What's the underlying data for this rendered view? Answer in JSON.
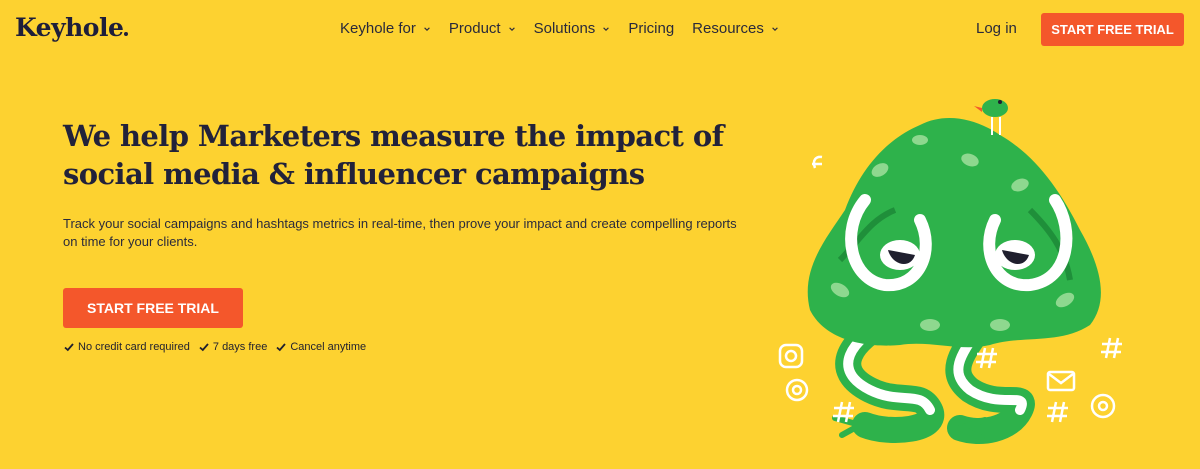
{
  "brand": {
    "name": "Keyhole"
  },
  "nav": {
    "items": [
      {
        "label": "Keyhole for",
        "dropdown": true
      },
      {
        "label": "Product",
        "dropdown": true
      },
      {
        "label": "Solutions",
        "dropdown": true
      },
      {
        "label": "Pricing",
        "dropdown": false
      },
      {
        "label": "Resources",
        "dropdown": true
      }
    ],
    "login_label": "Log in",
    "cta_label": "START FREE TRIAL"
  },
  "hero": {
    "headline": "We help Marketers measure the impact of social media & influencer campaigns",
    "subtext": "Track your social campaigns and hashtags metrics in real-time, then prove your impact and create compelling reports on time for your clients.",
    "cta_label": "START FREE TRIAL",
    "benefits": [
      "No credit card required",
      "7 days free",
      "Cancel anytime"
    ]
  },
  "colors": {
    "background": "#FDD230",
    "accent": "#F4572B",
    "text": "#22223a",
    "illustration_green": "#2EB24B"
  },
  "illustration": {
    "icons": [
      "facebook-icon",
      "instagram-icon",
      "at-icon",
      "hashtag-icon",
      "mail-icon",
      "bird-icon"
    ]
  }
}
